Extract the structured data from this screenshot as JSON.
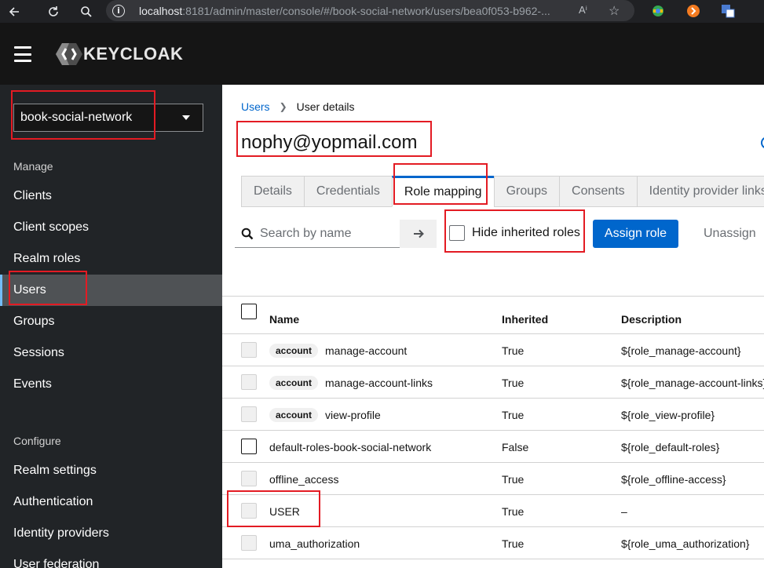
{
  "browser": {
    "url_host": "localhost",
    "url_rest": ":8181/admin/master/console/#/book-social-network/users/bea0f053-b962-...",
    "read_aloud": "Aⁱ",
    "star": "☆"
  },
  "header": {
    "brand": "KEYCLOAK"
  },
  "sidebar": {
    "realm": "book-social-network",
    "manage_label": "Manage",
    "manage_items": [
      {
        "label": "Clients"
      },
      {
        "label": "Client scopes"
      },
      {
        "label": "Realm roles"
      },
      {
        "label": "Users"
      },
      {
        "label": "Groups"
      },
      {
        "label": "Sessions"
      },
      {
        "label": "Events"
      }
    ],
    "configure_label": "Configure",
    "configure_items": [
      {
        "label": "Realm settings"
      },
      {
        "label": "Authentication"
      },
      {
        "label": "Identity providers"
      },
      {
        "label": "User federation"
      }
    ],
    "active_item": "Users"
  },
  "main": {
    "breadcrumb": {
      "link": "Users",
      "current": "User details"
    },
    "title": "nophy@yopmail.com",
    "tabs": [
      {
        "label": "Details"
      },
      {
        "label": "Credentials"
      },
      {
        "label": "Role mapping"
      },
      {
        "label": "Groups"
      },
      {
        "label": "Consents"
      },
      {
        "label": "Identity provider links"
      }
    ],
    "active_tab": "Role mapping",
    "toolbar": {
      "search_placeholder": "Search by name",
      "hide_inherited_label": "Hide inherited roles",
      "assign_label": "Assign role",
      "unassign_label": "Unassign"
    },
    "table": {
      "columns": {
        "name": "Name",
        "inherited": "Inherited",
        "description": "Description"
      },
      "rows": [
        {
          "client": "account",
          "name": "manage-account",
          "inherited": "True",
          "description": "${role_manage-account}"
        },
        {
          "client": "account",
          "name": "manage-account-links",
          "inherited": "True",
          "description": "${role_manage-account-links}"
        },
        {
          "client": "account",
          "name": "view-profile",
          "inherited": "True",
          "description": "${role_view-profile}"
        },
        {
          "client": "",
          "name": "default-roles-book-social-network",
          "inherited": "False",
          "description": "${role_default-roles}"
        },
        {
          "client": "",
          "name": "offline_access",
          "inherited": "True",
          "description": "${role_offline-access}"
        },
        {
          "client": "",
          "name": "USER",
          "inherited": "True",
          "description": "–"
        },
        {
          "client": "",
          "name": "uma_authorization",
          "inherited": "True",
          "description": "${role_uma_authorization}"
        }
      ]
    }
  },
  "colors": {
    "accent": "#0066cc",
    "highlight": "#e31b23",
    "sidebar_bg": "#212427",
    "header_bg": "#151515"
  }
}
